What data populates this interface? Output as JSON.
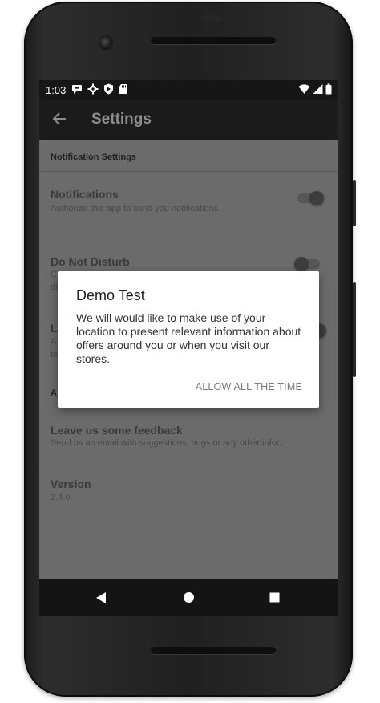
{
  "status_bar": {
    "time": "1:03",
    "left_icons": [
      "chat-icon",
      "settings-gear-icon",
      "shield-play-icon",
      "sd-card-icon"
    ],
    "right_icons": [
      "wifi-icon",
      "signal-icon",
      "battery-icon"
    ]
  },
  "app_bar": {
    "back_icon": "arrow-back-icon",
    "title": "Settings"
  },
  "settings": {
    "section_notification": "Notification Settings",
    "notifications": {
      "title": "Notifications",
      "subtitle": "Authorize this app to send you notifications."
    },
    "do_not_disturb": {
      "title": "Do Not Disturb",
      "subtitle_partial_1": "C",
      "subtitle_partial_2": "di"
    },
    "location": {
      "title_partial": "Lo",
      "subtitle_partial_1": "A",
      "subtitle_partial_2": "to"
    },
    "section_about_partial": "A",
    "feedback": {
      "title": "Leave us some feedback",
      "subtitle": "Send us an email with suggestions, bugs or any other infor..."
    },
    "version": {
      "title": "Version",
      "value": "2.4.0"
    }
  },
  "dialog": {
    "title": "Demo Test",
    "message": "We will would like to make use of your location to present relevant information about offers around you or when you visit our stores.",
    "button": "ALLOW ALL THE TIME"
  },
  "nav_bar": {
    "icons": [
      "back-triangle-icon",
      "home-circle-icon",
      "recents-square-icon"
    ]
  },
  "colors": {
    "scrim": "#6b6b6b",
    "app_bar": "#1b1b1b",
    "dialog_bg": "#ffffff"
  }
}
